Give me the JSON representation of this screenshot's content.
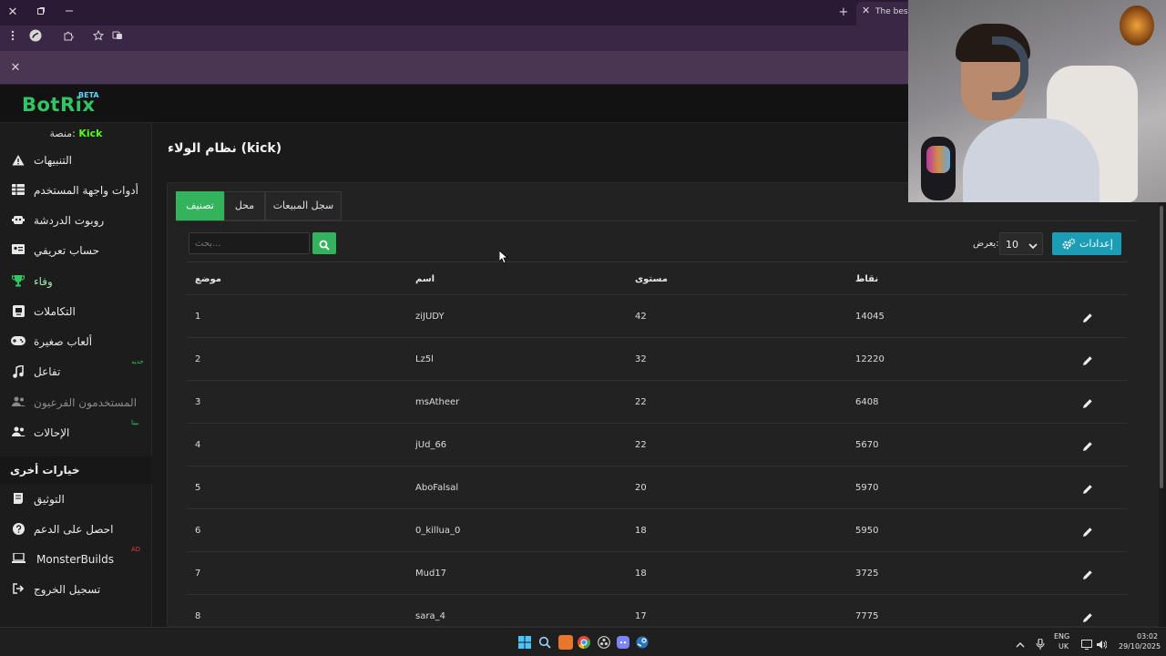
{
  "browser": {
    "active_tab_title": "The best C",
    "close_icon": "✕",
    "new_tab_icon": "+"
  },
  "site": {
    "logo_text": "BotRix",
    "logo_badge": "BETA",
    "accent_color": "#33c463",
    "platform_label": "منصة:",
    "platform_name": "Kick"
  },
  "sidebar": {
    "items": [
      {
        "label": "التنبيهات",
        "icon": "warning-icon"
      },
      {
        "label": "أدوات واجهة المستخدم",
        "icon": "table-icon"
      },
      {
        "label": "روبوت الدردشة",
        "icon": "robot-icon"
      },
      {
        "label": "حساب تعريفي",
        "icon": "id-card-icon"
      },
      {
        "label": "وفاء",
        "icon": "trophy-icon"
      },
      {
        "label": "التكاملات",
        "icon": "integrations-icon"
      },
      {
        "label": "ألعاب صغيرة",
        "icon": "gamepad-icon"
      },
      {
        "label": "تفاعل",
        "icon": "music-icon",
        "badge": "جديد"
      },
      {
        "label": "المستخدمون الفرعيون",
        "icon": "users-icon"
      },
      {
        "label": "الإحالات",
        "icon": "users-icon",
        "badge": "بيتا"
      }
    ],
    "other_section_title": "خيارات أخرى",
    "other_items": [
      {
        "label": "التوثيق",
        "icon": "scroll-icon"
      },
      {
        "label": "احصل على الدعم",
        "icon": "question-icon"
      },
      {
        "label": "MonsterBuilds",
        "icon": "laptop-icon",
        "badge": "AD"
      },
      {
        "label": "تسجيل الخروج",
        "icon": "logout-icon"
      }
    ]
  },
  "main": {
    "page_title": "نظام الولاء (kick)",
    "tabs": [
      "تصنيف",
      "محل",
      "سجل المبيعات"
    ],
    "search_placeholder": "بحث...",
    "length_label": "يعرض:",
    "length_value": "10",
    "settings_label": "إعدادات",
    "columns": [
      "موضع",
      "اسم",
      "مستوى",
      "نقاط"
    ],
    "rows": [
      {
        "rank": "1",
        "name": "ziJUDY",
        "level": "42",
        "points": "14045"
      },
      {
        "rank": "2",
        "name": "Lz5l",
        "level": "32",
        "points": "12220"
      },
      {
        "rank": "3",
        "name": "msAtheer",
        "level": "22",
        "points": "6408"
      },
      {
        "rank": "4",
        "name": "jUd_66",
        "level": "22",
        "points": "5670"
      },
      {
        "rank": "5",
        "name": "AboFalsal",
        "level": "20",
        "points": "5970"
      },
      {
        "rank": "6",
        "name": "0_killua_0",
        "level": "18",
        "points": "5950"
      },
      {
        "rank": "7",
        "name": "Mud17",
        "level": "18",
        "points": "3725"
      },
      {
        "rank": "8",
        "name": "sara_4",
        "level": "17",
        "points": "7775"
      }
    ]
  },
  "taskbar": {
    "lang_top": "ENG",
    "lang_bottom": "UK",
    "time": "03:02",
    "date": "29/10/2025"
  }
}
